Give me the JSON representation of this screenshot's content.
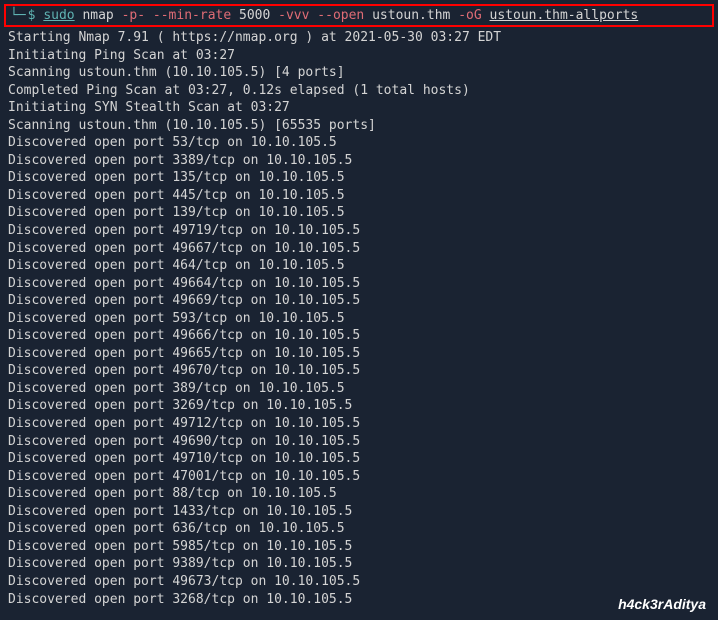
{
  "prompt": {
    "icon": "└─",
    "dollar": "$",
    "sudo": "sudo",
    "cmd": "nmap",
    "flag_p": "-p-",
    "flag_minrate": "--min-rate",
    "rate": "5000",
    "flag_vvv": "-vvv",
    "flag_open": "--open",
    "target": "ustoun.thm",
    "flag_oG": "-oG",
    "outfile": "ustoun.thm-allports"
  },
  "lines": [
    "Starting Nmap 7.91 ( https://nmap.org ) at 2021-05-30 03:27 EDT",
    "Initiating Ping Scan at 03:27",
    "Scanning ustoun.thm (10.10.105.5) [4 ports]",
    "Completed Ping Scan at 03:27, 0.12s elapsed (1 total hosts)",
    "Initiating SYN Stealth Scan at 03:27",
    "Scanning ustoun.thm (10.10.105.5) [65535 ports]",
    "Discovered open port 53/tcp on 10.10.105.5",
    "Discovered open port 3389/tcp on 10.10.105.5",
    "Discovered open port 135/tcp on 10.10.105.5",
    "Discovered open port 445/tcp on 10.10.105.5",
    "Discovered open port 139/tcp on 10.10.105.5",
    "Discovered open port 49719/tcp on 10.10.105.5",
    "Discovered open port 49667/tcp on 10.10.105.5",
    "Discovered open port 464/tcp on 10.10.105.5",
    "Discovered open port 49664/tcp on 10.10.105.5",
    "Discovered open port 49669/tcp on 10.10.105.5",
    "Discovered open port 593/tcp on 10.10.105.5",
    "Discovered open port 49666/tcp on 10.10.105.5",
    "Discovered open port 49665/tcp on 10.10.105.5",
    "Discovered open port 49670/tcp on 10.10.105.5",
    "Discovered open port 389/tcp on 10.10.105.5",
    "Discovered open port 3269/tcp on 10.10.105.5",
    "Discovered open port 49712/tcp on 10.10.105.5",
    "Discovered open port 49690/tcp on 10.10.105.5",
    "Discovered open port 49710/tcp on 10.10.105.5",
    "Discovered open port 47001/tcp on 10.10.105.5",
    "Discovered open port 88/tcp on 10.10.105.5",
    "Discovered open port 1433/tcp on 10.10.105.5",
    "Discovered open port 636/tcp on 10.10.105.5",
    "Discovered open port 5985/tcp on 10.10.105.5",
    "Discovered open port 9389/tcp on 10.10.105.5",
    "Discovered open port 49673/tcp on 10.10.105.5",
    "Discovered open port 3268/tcp on 10.10.105.5"
  ],
  "watermark": "h4ck3rAditya"
}
